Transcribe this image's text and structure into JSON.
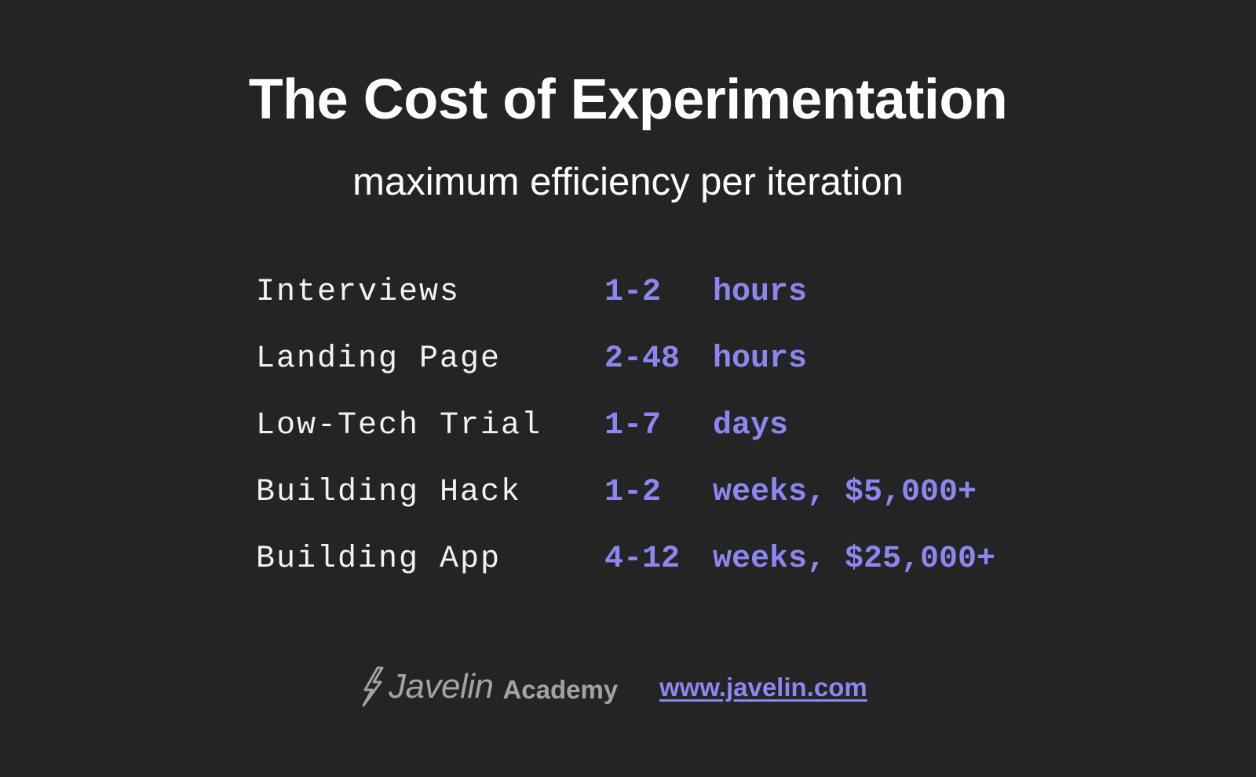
{
  "slide": {
    "title": "The Cost of Experimentation",
    "subtitle": "maximum efficiency per iteration",
    "rows": [
      {
        "label": "Interviews",
        "range": "1-2",
        "unit": "hours"
      },
      {
        "label": "Landing Page",
        "range": "2-48",
        "unit": "hours"
      },
      {
        "label": "Low-Tech Trial",
        "range": "1-7",
        "unit": "days"
      },
      {
        "label": "Building Hack",
        "range": "1-2",
        "unit": "weeks, $5,000+"
      },
      {
        "label": "Building App",
        "range": "4-12",
        "unit": "weeks, $25,000+"
      }
    ]
  },
  "footer": {
    "logo_word": "Javelin",
    "logo_sub": "Academy",
    "logo_icon": "lightning-bolt-icon",
    "link_text": "www.javelin.com"
  },
  "colors": {
    "background": "#242424",
    "accent": "#8c87f0",
    "text": "#ffffff",
    "logo": "#a3a3a3"
  }
}
